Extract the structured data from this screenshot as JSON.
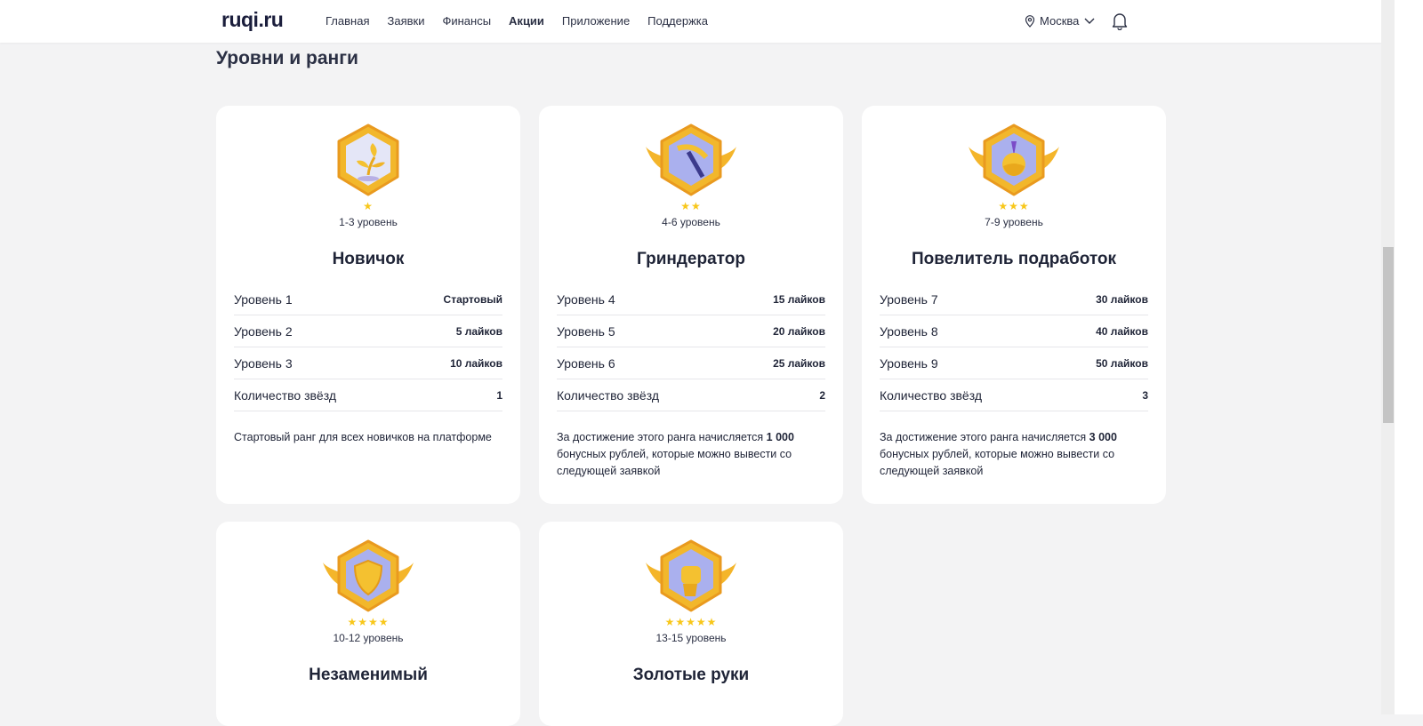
{
  "header": {
    "logo": "ruqi.ru",
    "nav": [
      "Главная",
      "Заявки",
      "Финансы",
      "Акции",
      "Приложение",
      "Поддержка"
    ],
    "active": "Акции",
    "city": "Москва"
  },
  "page_title": "Уровни и ранги",
  "cards": [
    {
      "stars": "★",
      "level_range": "1-3 уровень",
      "title": "Новичок",
      "rows": [
        [
          "Уровень 1",
          "Стартовый"
        ],
        [
          "Уровень 2",
          "5 лайков"
        ],
        [
          "Уровень 3",
          "10 лайков"
        ],
        [
          "Количество звёзд",
          "1"
        ]
      ],
      "desc_pre": "Стартовый ранг для всех новичков на платформе",
      "desc_bold": "",
      "desc_post": "",
      "icon": "sprout",
      "wings": false
    },
    {
      "stars": "★★",
      "level_range": "4-6 уровень",
      "title": "Гриндератор",
      "rows": [
        [
          "Уровень 4",
          "15 лайков"
        ],
        [
          "Уровень 5",
          "20 лайков"
        ],
        [
          "Уровень 6",
          "25 лайков"
        ],
        [
          "Количество звёзд",
          "2"
        ]
      ],
      "desc_pre": "За достижение этого ранга начисляется ",
      "desc_bold": "1 000",
      "desc_post": " бонусных рублей, которые можно вывести со следующей заявкой",
      "icon": "pickaxe",
      "wings": true
    },
    {
      "stars": "★★★",
      "level_range": "7-9 уровень",
      "title": "Повелитель подработок",
      "rows": [
        [
          "Уровень 7",
          "30 лайков"
        ],
        [
          "Уровень 8",
          "40 лайков"
        ],
        [
          "Уровень 9",
          "50 лайков"
        ],
        [
          "Количество звёзд",
          "3"
        ]
      ],
      "desc_pre": "За достижение этого ранга начисляется ",
      "desc_bold": "3 000",
      "desc_post": " бонусных рублей, которые можно вывести со следующей заявкой",
      "icon": "medal",
      "wings": true
    },
    {
      "stars": "★★★★",
      "level_range": "10-12 уровень",
      "title": "Незаменимый",
      "icon": "shield",
      "wings": true
    },
    {
      "stars": "★★★★★",
      "level_range": "13-15 уровень",
      "title": "Золотые руки",
      "icon": "fist",
      "wings": true
    }
  ]
}
